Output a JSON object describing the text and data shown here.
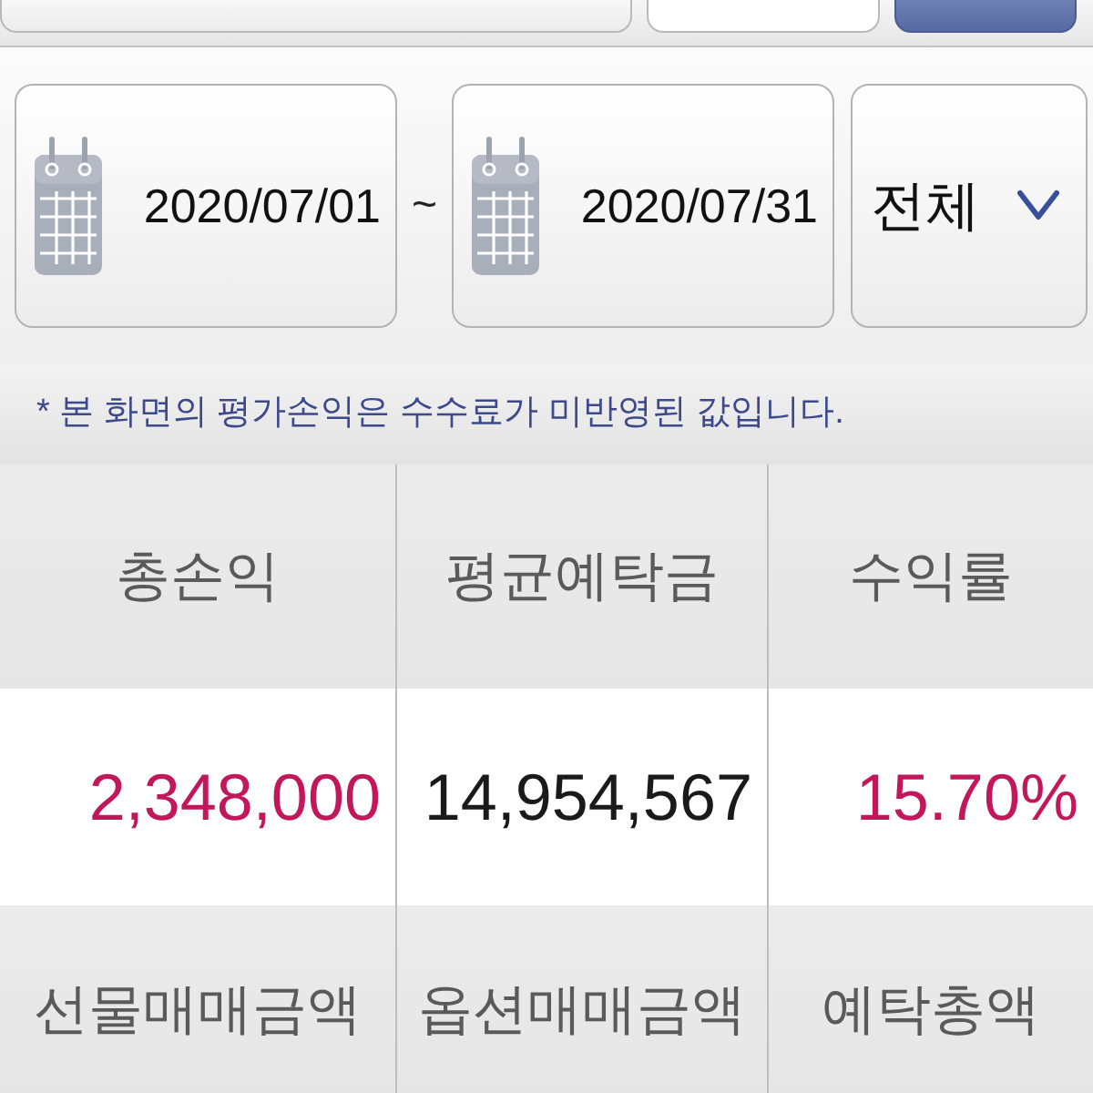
{
  "date_range": {
    "start": "2020/07/01",
    "separator": "~",
    "end": "2020/07/31"
  },
  "filter": {
    "value": "전체"
  },
  "notice": "* 본 화면의 평가손익은 수수료가 미반영된 값입니다.",
  "metrics": [
    {
      "label": "총손익",
      "value": "2,348,000",
      "color": "#c2185b"
    },
    {
      "label": "평균예탁금",
      "value": "14,954,567",
      "color": "#1a1a1a"
    },
    {
      "label": "수익률",
      "value": "15.70%",
      "color": "#c2185b"
    }
  ],
  "metrics_2": [
    {
      "label": "선물매매금액"
    },
    {
      "label": "옵션매매금액"
    },
    {
      "label": "예탁총액"
    }
  ]
}
